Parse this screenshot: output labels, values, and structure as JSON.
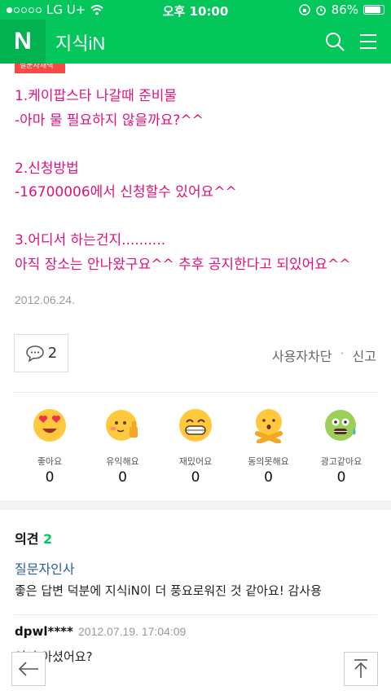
{
  "status": {
    "carrier": "LG U+",
    "time": "오후 10:00",
    "battery": "86%",
    "battery_level": 0.86
  },
  "header": {
    "logo": "N",
    "title": "지식iN"
  },
  "answer": {
    "tag": "질문자채택",
    "lines": [
      "1.케이팝스타 나갈때 준비물",
      "-아마 물 필요하지 않을까요?^^",
      "",
      "2.신청방법",
      "-16700006에서 신청할수 있어요^^",
      "",
      "3.어디서 하는건지..........",
      "아직 장소는 안나왔구요^^ 추후 공지한다고 되있어요^^"
    ],
    "date": "2012.06.24.",
    "comment_count": "2",
    "block_label": "사용자차단",
    "separator": "·",
    "report_label": "신고"
  },
  "reactions": [
    {
      "label": "좋아요",
      "count": "0",
      "icon": "heart-eyes-icon"
    },
    {
      "label": "유익해요",
      "count": "0",
      "icon": "thumbs-up-icon"
    },
    {
      "label": "재밌어요",
      "count": "0",
      "icon": "grin-icon"
    },
    {
      "label": "동의못해요",
      "count": "0",
      "icon": "arms-crossed-icon"
    },
    {
      "label": "광고같아요",
      "count": "0",
      "icon": "sick-face-icon"
    }
  ],
  "opinions": {
    "title": "의견",
    "count": "2",
    "first": {
      "name": "질문자인사",
      "text": "좋은 답변 덕분에 지식iN이 더 풍요로워진 것 같아요! 감사용"
    },
    "comment": {
      "user": "dpwl****",
      "time": "2012.07.19. 17:04:09",
      "text": "어서 아셨어요?"
    }
  },
  "colors": {
    "brand": "#03c75a",
    "answer_text": "#e0117a",
    "link": "#2c5aa0",
    "tag": "#f54a45"
  }
}
